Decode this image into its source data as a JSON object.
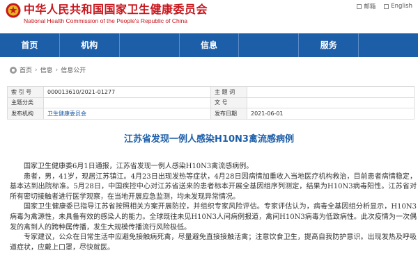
{
  "header": {
    "title_cn": "中华人民共和国国家卫生健康委员会",
    "title_en": "National Health Commission of the People's Republic of China",
    "links": [
      "邮箱",
      "English"
    ]
  },
  "nav": {
    "items": [
      "首页",
      "机构",
      "",
      "信息",
      "",
      "服务",
      ""
    ]
  },
  "breadcrumb": [
    "首页",
    "信息",
    "信息公开"
  ],
  "info": {
    "labels": {
      "index": "索 引 号",
      "category": "主题分类",
      "issuer": "发布机构",
      "keywords": "主 题 词",
      "doc_no": "文 号",
      "date": "发布日期"
    },
    "values": {
      "index": "000013610/2021-01277",
      "category": "",
      "issuer": "卫生健康委员会",
      "keywords": "",
      "doc_no": "",
      "date": "2021-06-01"
    }
  },
  "article": {
    "title": "江苏省发现一例人感染H10N3禽流感病例",
    "paragraphs": [
      "国家卫生健康委6月1日通报，江苏省发现一例人感染H10N3禽流感病例。",
      "患者，男，41岁，现居江苏镇江。4月23日出现发热等症状，4月28日因病情加重收入当地医疗机构救治，目前患者病情稳定，基本达到出院标准。5月28日，中国疾控中心对江苏省送来的患者标本开展全基因组序列测定，结果为H10N3病毒阳性。江苏省对所有密切接触者进行医学观察，在当地开展应急监测，均未发现异常情况。",
      "国家卫生健康委已指导江苏省按照相关方案开展防控，并组织专家风险评估。专家评估认为，病毒全基因组分析显示，H10N3病毒为禽源性，未具备有效的感染人的能力。全球既往未见H10N3人间病例报道，禽间H10N3病毒为低致病性。此次疫情为一次偶发的禽到人的跨种属传播，发生大规模传播流行风险极低。",
      "专家建议，公众在日常生活中应避免接触病死禽，尽量避免直接接触活禽；注意饮食卫生，提高自我防护意识。出现发热及呼吸道症状，应戴上口罩，尽快就医。"
    ]
  },
  "colors": {
    "brand_red": "#c8161d",
    "nav_blue": "#1d5ea8"
  }
}
